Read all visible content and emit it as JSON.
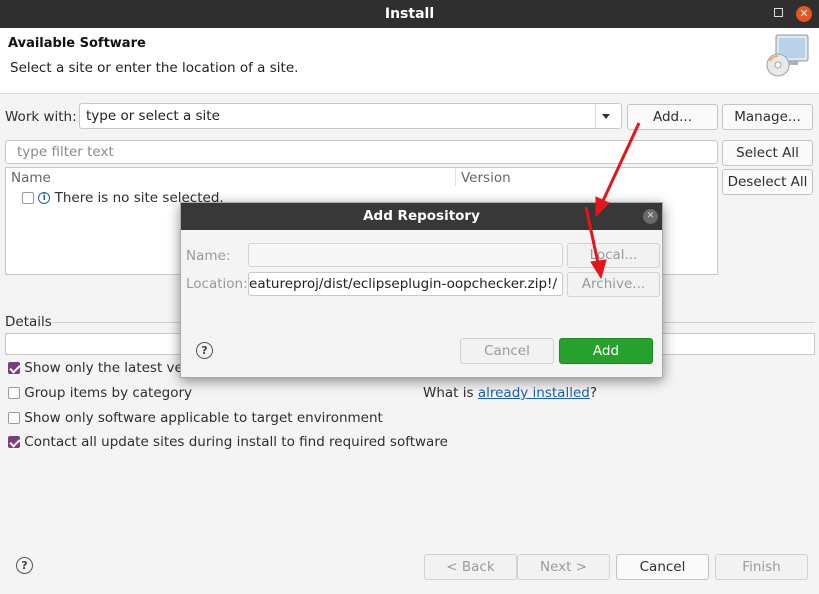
{
  "window": {
    "title": "Install"
  },
  "header": {
    "title": "Available Software",
    "subtitle": "Select a site or enter the location of a site."
  },
  "work_with": {
    "label": "Work with:",
    "placeholder": "type or select a site",
    "add_label": "Add...",
    "manage_label": "Manage..."
  },
  "filter": {
    "placeholder": "type filter text"
  },
  "table": {
    "columns": [
      "Name",
      "Version"
    ],
    "rows": [
      {
        "name": "There is no site selected."
      }
    ]
  },
  "side_buttons": {
    "select_all": "Select All",
    "deselect_all": "Deselect All"
  },
  "details": {
    "label": "Details"
  },
  "options": {
    "latest_versions": {
      "label": "Show only the latest versions of available software",
      "checked": true
    },
    "group_by_category": {
      "label": "Group items by category",
      "checked": false
    },
    "applicable_only": {
      "label": "Show only software applicable to target environment",
      "checked": false
    },
    "contact_all": {
      "label": "Contact all update sites during install to find required software",
      "checked": true
    }
  },
  "installed_link": {
    "prefix": "What is ",
    "link": "already installed",
    "suffix": "?"
  },
  "footer": {
    "back": "< Back",
    "next": "Next >",
    "cancel": "Cancel",
    "finish": "Finish"
  },
  "dialog": {
    "title": "Add Repository",
    "name_label": "Name:",
    "name_value": "",
    "location_label": "Location:",
    "location_value": "jar:file:/home/user/eclipse-workspace/featureproj/dist/eclipseplugin-oopchecker.zip!/",
    "local_label": "Local...",
    "archive_label": "Archive...",
    "cancel_label": "Cancel",
    "add_label": "Add"
  },
  "colors": {
    "accent_green": "#26a12b",
    "checkbox_purple": "#7a3e78",
    "annotation_red": "#e8141c",
    "link_blue": "#1a5fb4"
  }
}
